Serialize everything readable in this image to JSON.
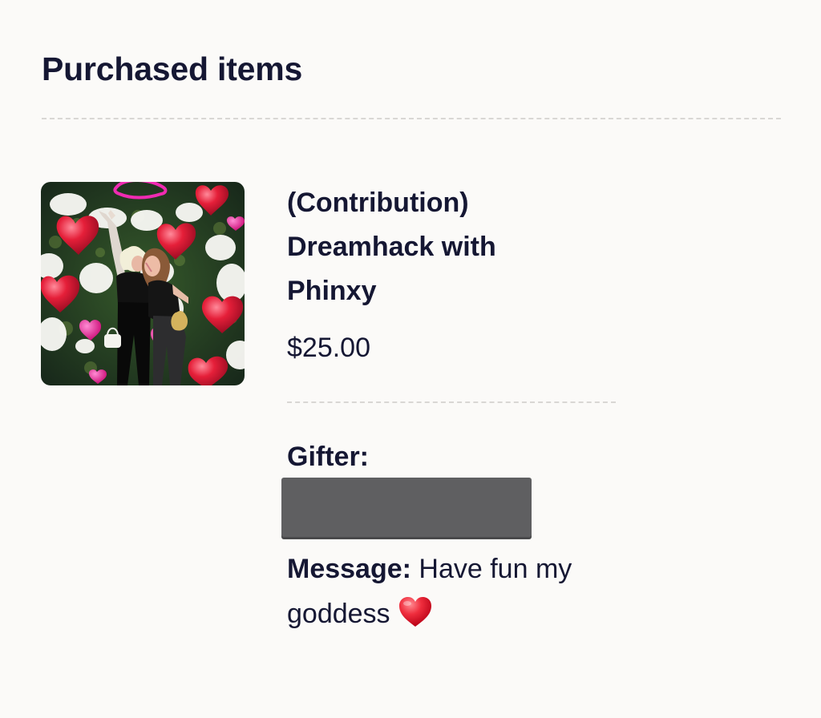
{
  "section": {
    "title": "Purchased items"
  },
  "item": {
    "title": "(Contribution) Dreamhack with Phinxy",
    "price": "$25.00",
    "image_icon": "product-photo"
  },
  "gift": {
    "gifter_label": "Gifter:",
    "gifter_name_hidden": true,
    "message_label": "Message:",
    "message_text": "Have fun my goddess",
    "message_emoji": "heart-icon"
  },
  "colors": {
    "background": "#fbfaf8",
    "text": "#151733",
    "redaction": "#5f5f61",
    "divider": "#d9d7d4"
  }
}
